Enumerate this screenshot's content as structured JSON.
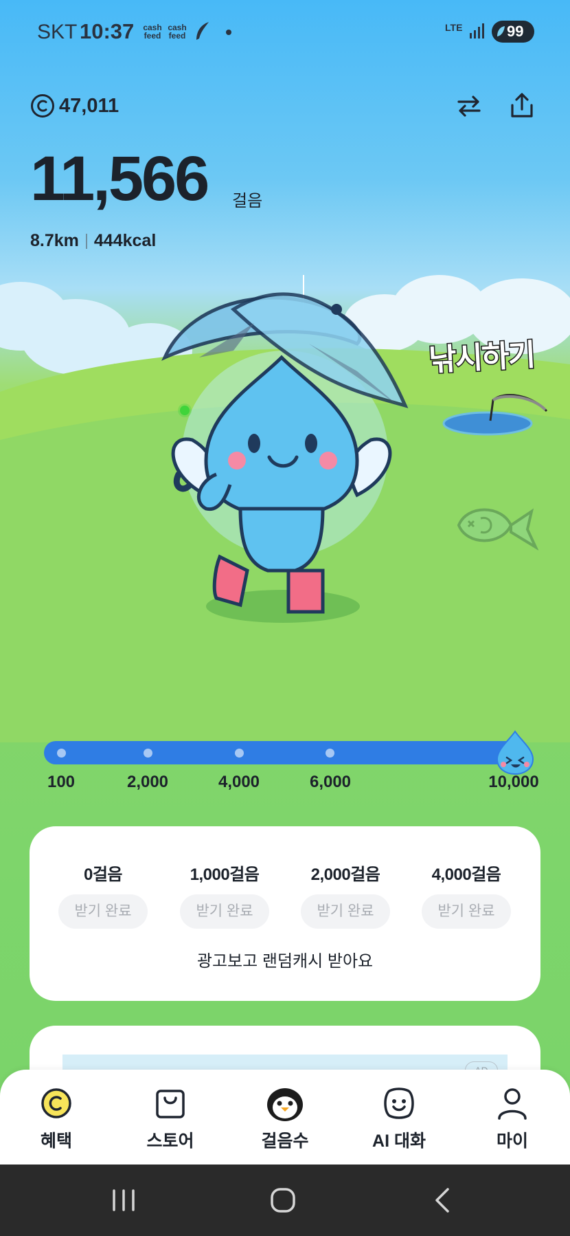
{
  "status_bar": {
    "carrier": "SKT",
    "time": "10:37",
    "app_icons": [
      "cash feed",
      "cash feed"
    ],
    "network": "LTE",
    "battery": "99"
  },
  "header": {
    "coin_balance": "47,011",
    "icons": [
      "coin-icon",
      "swap-icon",
      "share-icon"
    ]
  },
  "steps": {
    "count": "11,566",
    "unit": "걸음",
    "distance": "8.7km",
    "calories": "444kcal"
  },
  "scene": {
    "fishing_label": "낚시하기"
  },
  "progress": {
    "milestones": [
      "100",
      "2,000",
      "4,000",
      "6,000",
      "10,000"
    ],
    "fraction": 1.0
  },
  "rewards": {
    "items": [
      {
        "steps": "0걸음",
        "button": "받기 완료"
      },
      {
        "steps": "1,000걸음",
        "button": "받기 완료"
      },
      {
        "steps": "2,000걸음",
        "button": "받기 완료"
      },
      {
        "steps": "4,000걸음",
        "button": "받기 완료"
      }
    ],
    "ad_text": "광고보고 랜덤캐시 받아요"
  },
  "ad_card": {
    "badge": "AD"
  },
  "bottom_nav": {
    "items": [
      {
        "label": "혜택",
        "icon": "coin-icon"
      },
      {
        "label": "스토어",
        "icon": "shopping-bag-icon"
      },
      {
        "label": "걸음수",
        "icon": "penguin-icon"
      },
      {
        "label": "AI 대화",
        "icon": "chat-face-icon"
      },
      {
        "label": "마이",
        "icon": "person-icon"
      }
    ]
  },
  "colors": {
    "sky": "#48b9f7",
    "grass": "#7dd56b",
    "progress_bar": "#2f7de4",
    "coin_yellow": "#f7e45a"
  }
}
